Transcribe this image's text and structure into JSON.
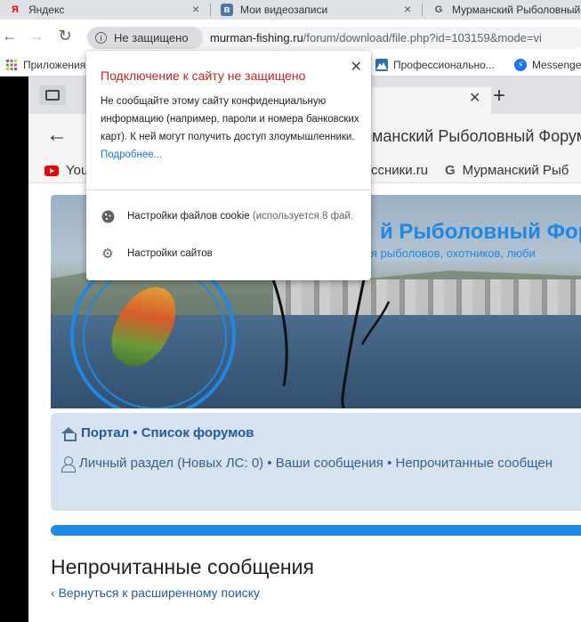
{
  "tabs": [
    {
      "label": "Яндекс",
      "icon": "yandex-icon"
    },
    {
      "label": "Мои видеозаписи",
      "icon": "vk-icon"
    },
    {
      "label": "Мурманский Рыболовный",
      "icon": "forum-icon"
    }
  ],
  "toolbar": {
    "security_label": "Не защищено",
    "url_host": "murman-fishing.ru",
    "url_path": "/forum/download/file.php?id=103159&mode=vi"
  },
  "bookmarks": [
    {
      "label": "Приложения",
      "icon": "apps-grid-icon"
    },
    {
      "label": "Профессионально...",
      "icon": "mountain-icon"
    },
    {
      "label": "Messenge",
      "icon": "messenger-icon"
    }
  ],
  "inner": {
    "title": "рманский Рыболовный Форум",
    "bookmarks": [
      "You",
      "ссники.ru",
      "Мурманский Рыб"
    ],
    "banner_title": "й Рыболовный Фор",
    "banner_sub": "я рыболовов, охотников, люби",
    "nav_line1": "Портал • Список форумов",
    "nav_line2": "Личный раздел (Новых ЛС: 0) • Ваши сообщения • Непрочитанные сообщен",
    "page_title": "Непрочитанные сообщения",
    "back_link": "Вернуться к расширенному поиску"
  },
  "popup": {
    "title": "Подключение к сайту не защищено",
    "body": "Не сообщайте этому сайту конфиденциальную информацию (например, пароли и номера банковских карт). К ней могут получить доступ злоумышленники.",
    "more_link": "Подробнее...",
    "cookie_label": "Настройки файлов cookie",
    "cookie_hint": "(используется 8 фай.",
    "site_settings_label": "Настройки сайтов"
  },
  "colors": {
    "warning": "#c5221f",
    "link": "#1a73e8",
    "forum_blue": "#1e88e5"
  }
}
